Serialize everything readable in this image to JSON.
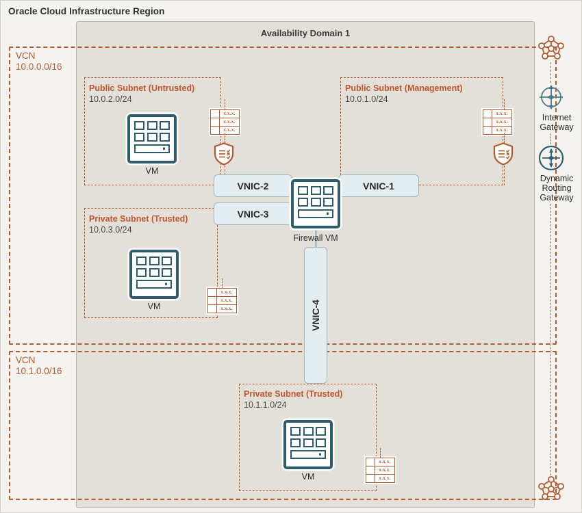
{
  "region": {
    "title": "Oracle Cloud Infrastructure Region"
  },
  "availability_domain": {
    "title": "Availability Domain 1"
  },
  "vcns": [
    {
      "name": "VCN",
      "cidr": "10.0.0.0/16"
    },
    {
      "name": "VCN",
      "cidr": "10.1.0.0/16"
    }
  ],
  "subnets": [
    {
      "title": "Public Subnet (Untrusted)",
      "cidr": "10.0.2.0/24"
    },
    {
      "title": "Public Subnet (Management)",
      "cidr": "10.0.1.0/24"
    },
    {
      "title": "Private Subnet (Trusted)",
      "cidr": "10.0.3.0/24"
    },
    {
      "title": "Private Subnet (Trusted)",
      "cidr": "10.1.1.0/24"
    }
  ],
  "instances": [
    {
      "label": "VM"
    },
    {
      "label": "VM"
    },
    {
      "label": "VM"
    },
    {
      "label": "Firewall VM"
    }
  ],
  "vnics": [
    {
      "label": "VNIC-1"
    },
    {
      "label": "VNIC-2"
    },
    {
      "label": "VNIC-3"
    },
    {
      "label": "VNIC-4"
    }
  ],
  "route_table": {
    "rows": [
      "x.x.x.",
      "x.x.x.",
      "x.x.x."
    ]
  },
  "gateways": [
    {
      "label": "Internet\nGateway",
      "line1": "Internet",
      "line2": "Gateway",
      "icon": "internet-gateway-icon"
    },
    {
      "label": "Dynamic Routing Gateway",
      "line1": "Dynamic",
      "line2": "Routing",
      "line3": "Gateway",
      "icon": "dynamic-routing-gateway-icon"
    }
  ],
  "network_clouds": [
    {
      "icon": "network-cloud-icon"
    },
    {
      "icon": "network-cloud-icon"
    }
  ],
  "colors": {
    "accent_orange": "#b05a2e",
    "subnet_title": "#c0562a",
    "teal": "#2e5c6e",
    "vnic_fill": "#e4eef0",
    "ad_fill": "#e3e0da",
    "canvas_fill": "#f4f3f0"
  }
}
